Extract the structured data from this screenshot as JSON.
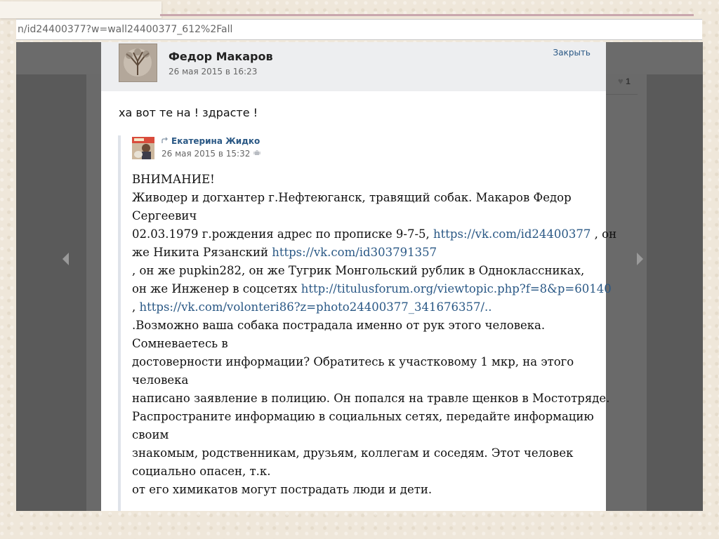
{
  "browser": {
    "url": "n/id24400377?w=wall24400377_612%2Fall"
  },
  "background_post": {
    "like_count": "1"
  },
  "post": {
    "author": "Федор Макаров",
    "date": "26 мая 2015 в 16:23",
    "close_label": "Закрыть",
    "text": "ха вот те на ! здрасте !"
  },
  "repost": {
    "author": "Екатерина Жидко",
    "date": "26 мая 2015 в 15:32",
    "lines": [
      {
        "t1": "ВНИМАНИЕ!"
      },
      {
        "t1": "Живодер и догхантер г.Нефтеюганск, травящий собак. Макаров Федор"
      },
      {
        "t1": "Сергеевич"
      },
      {
        "t1": "02.03.1979 г.рождения адрес по прописке 9-7-5, ",
        "link": "https://vk.com/id24400377",
        "t2": " , он"
      },
      {
        "t1": "же Никита Рязанский ",
        "link": "https://vk.com/id303791357"
      },
      {
        "t1": ", он же pupkin282, он же Тугрик Монгольский рублик в Одноклассниках,"
      },
      {
        "t1": "он же Инженер в соцсетях ",
        "link": "http://titulusforum.org/viewtopic.php?f=8&p=60140"
      },
      {
        "t1": ", ",
        "link": "https://vk.com/volonteri86?z=photo24400377_341676357/.."
      },
      {
        "t1": ".Возможно ваша собака пострадала именно от рук этого человека."
      },
      {
        "t1": "Сомневаетесь в"
      },
      {
        "t1": "достоверности информации? Обратитесь к участковому 1 мкр, на этого"
      },
      {
        "t1": "человека"
      },
      {
        "t1": "написано заявление в полицию. Он попался на травле щенков в Мостотряде."
      },
      {
        "t1": "Распространите информацию в социальных сетях, передайте информацию"
      },
      {
        "t1": "своим"
      },
      {
        "t1": "знакомым, родственникам, друзьям, коллегам и соседям. Этот человек"
      },
      {
        "t1": "социально опасен, т.к."
      },
      {
        "t1": "от его химикатов могут пострадать люди и дети."
      }
    ]
  },
  "icons": {
    "repost": "repost-arrow-icon",
    "device": "android-icon",
    "like": "heart-icon",
    "prev": "arrow-left-icon",
    "next": "arrow-right-icon"
  },
  "colors": {
    "link": "#2a5885",
    "header_bg": "#edeef0",
    "overlay": "#5a5a5a"
  }
}
